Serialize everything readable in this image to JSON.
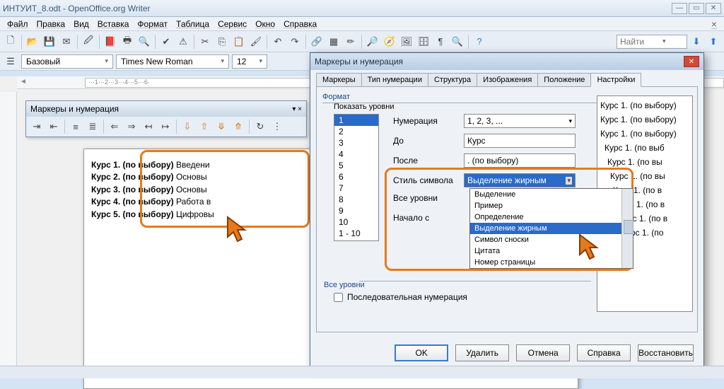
{
  "window": {
    "title": "ИНТУИТ_8.odt - OpenOffice.org Writer"
  },
  "menu": {
    "items": [
      "Файл",
      "Правка",
      "Вид",
      "Вставка",
      "Формат",
      "Таблица",
      "Сервис",
      "Окно",
      "Справка"
    ]
  },
  "toolbar_find": {
    "label": "Найти"
  },
  "formatting": {
    "style": "Базовый",
    "font": "Times New Roman",
    "size": "12"
  },
  "float_panel": {
    "title": "Маркеры и нумерация"
  },
  "ruler_text": "···1···2···3···4···5···6·",
  "document": {
    "lines": [
      {
        "b": "Курс 1. (по выбору)",
        "t": "  Введени"
      },
      {
        "b": "Курс 2. (по выбору)",
        "t": "  Основы "
      },
      {
        "b": "Курс 3. (по выбору)",
        "t": "  Основы "
      },
      {
        "b": "Курс 4. (по выбору)",
        "t": "  Работа в"
      },
      {
        "b": "Курс 5. (по выбору)",
        "t": "  Цифровы"
      }
    ]
  },
  "dialog": {
    "title": "Маркеры и нумерация",
    "tabs": [
      "Маркеры",
      "Тип нумерации",
      "Структура",
      "Изображения",
      "Положение",
      "Настройки"
    ],
    "active_tab": 5,
    "format_label": "Формат",
    "show_levels_label": "Показать уровни",
    "levels": [
      "1",
      "2",
      "3",
      "4",
      "5",
      "6",
      "7",
      "8",
      "9",
      "10",
      "1 - 10"
    ],
    "fields": {
      "numbering_label": "Нумерация",
      "numbering_value": "1, 2, 3, ...",
      "before_label": "До",
      "before_value": "Курс",
      "after_label": "После",
      "after_value": ". (по выбору)",
      "charstyle_label": "Стиль символа",
      "charstyle_value": "Выделение жирным",
      "alllevels_label": "Все уровни",
      "startat_label": "Начало с",
      "alllevels2_label": "Все уровни",
      "sequential_label": "Последовательная нумерация"
    },
    "dropdown_options": [
      "Выделение",
      "Пример",
      "Определение",
      "Выделение жирным",
      "Символ сноски",
      "Цитата",
      "Номер страницы"
    ],
    "dropdown_highlight": 3,
    "preview_lines": [
      "Курс 1. (по выбору)",
      "Курс 1. (по выбору)",
      "Курс 1. (по выбору)",
      "Курс 1. (по выб",
      "Курс 1. (по вы",
      "Курс 1. (по вы",
      "Курс 1. (по в",
      "Курс 1. (по в",
      "Курс 1. (по в",
      "Курс 1. (по"
    ],
    "buttons": {
      "ok": "OK",
      "delete": "Удалить",
      "cancel": "Отмена",
      "help": "Справка",
      "restore": "Восстановить"
    }
  }
}
